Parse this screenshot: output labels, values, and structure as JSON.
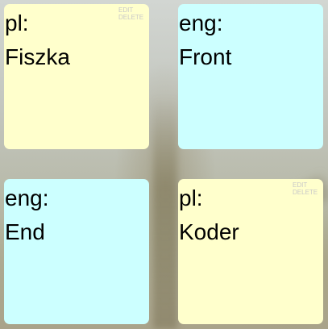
{
  "cards": [
    {
      "lang": "pl:",
      "word": "Fiszka",
      "color": "#ffffcc",
      "actions": {
        "edit": "EDIT",
        "delete": "DELETE"
      }
    },
    {
      "lang": "eng:",
      "word": "Front",
      "color": "#ccffff"
    },
    {
      "lang": "eng:",
      "word": "End",
      "color": "#ccffff"
    },
    {
      "lang": "pl:",
      "word": "Koder",
      "color": "#ffffcc",
      "actions": {
        "edit": "EDIT",
        "delete": "DELETE"
      }
    }
  ]
}
